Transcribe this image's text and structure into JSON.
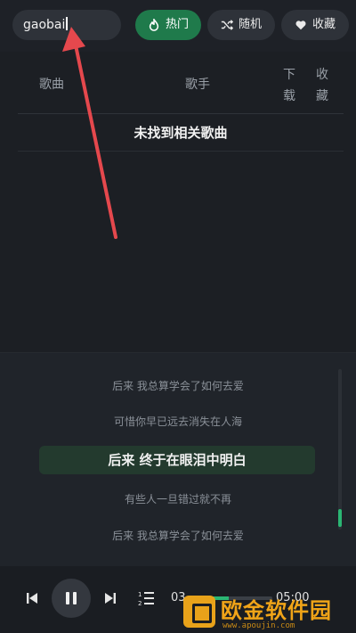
{
  "search": {
    "value": "gaobai"
  },
  "tabs": [
    {
      "label": "热门",
      "icon": "flame-icon",
      "active": true
    },
    {
      "label": "随机",
      "icon": "shuffle-icon",
      "active": false
    },
    {
      "label": "收藏",
      "icon": "heart-icon",
      "active": false
    }
  ],
  "table": {
    "headers": {
      "song": "歌曲",
      "singer": "歌手",
      "download": "下载",
      "favorite": "收藏"
    },
    "empty_message": "未找到相关歌曲"
  },
  "lyrics": {
    "lines": [
      "后来 我总算学会了如何去爱",
      "可惜你早已远去消失在人海",
      "后来 终于在眼泪中明白",
      "有些人一旦错过就不再",
      "后来 我总算学会了如何去爱"
    ],
    "current_index": 2
  },
  "player": {
    "current_time": "03",
    "total_time": "05:00",
    "progress": 0.3
  },
  "watermark": {
    "text": "欧金软件园",
    "url": "www.apoujin.com"
  },
  "colors": {
    "accent": "#1f7a4b",
    "green": "#2bb673",
    "annotation": "#e5484d",
    "watermark": "#f0a418"
  }
}
